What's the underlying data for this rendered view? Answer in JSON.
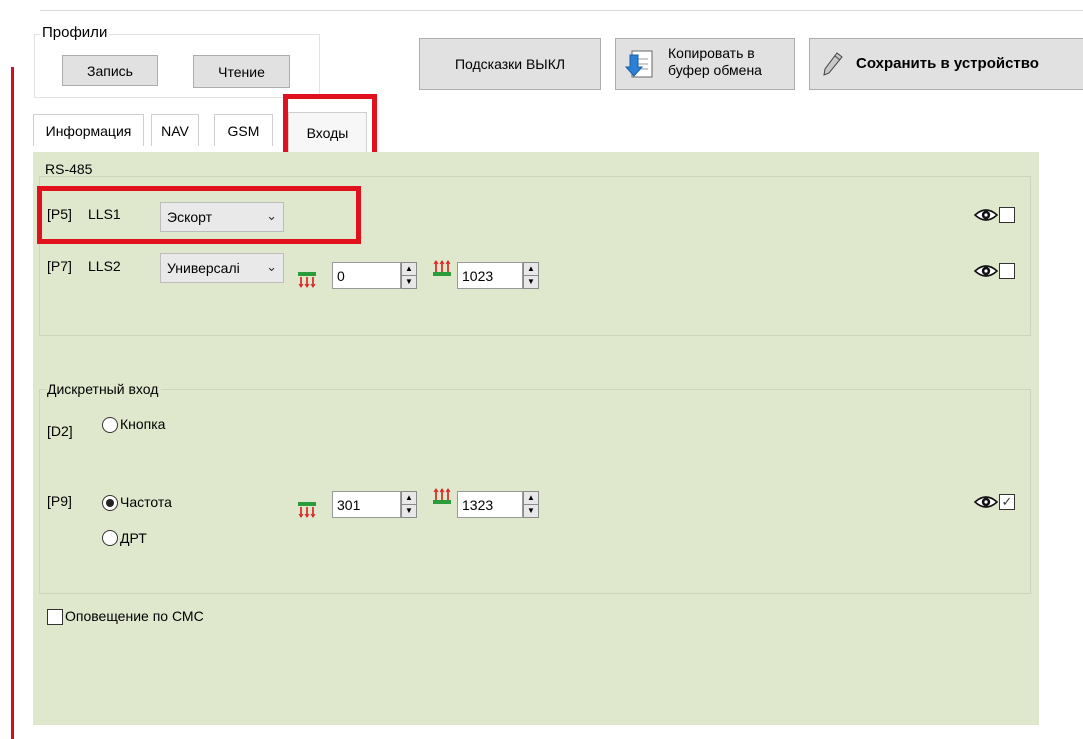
{
  "profiles": {
    "title": "Профили",
    "write_label": "Запись",
    "read_label": "Чтение"
  },
  "toolbar": {
    "hints_label": "Подсказки ВЫКЛ",
    "copy_label_line1": "Копировать в",
    "copy_label_line2": "буфер обмена",
    "save_label": "Сохранить в устройство"
  },
  "tabs": [
    {
      "label": "Информация"
    },
    {
      "label": "NAV"
    },
    {
      "label": "GSM"
    },
    {
      "label": "Входы",
      "active": true
    }
  ],
  "rs485": {
    "title": "RS-485",
    "rows": [
      {
        "port": "[P5]",
        "name": "LLS1",
        "mode": "Эскорт",
        "visible_checked": false
      },
      {
        "port": "[P7]",
        "name": "LLS2",
        "mode": "Универсалі",
        "min": "0",
        "max": "1023",
        "visible_checked": false
      }
    ]
  },
  "discrete": {
    "title": "Дискретный вход",
    "d2": {
      "port": "[D2]",
      "option": "Кнопка",
      "selected": false
    },
    "p9": {
      "port": "[P9]",
      "options": [
        {
          "label": "Частота",
          "selected": true
        },
        {
          "label": "ДРТ",
          "selected": false
        }
      ],
      "min": "301",
      "max": "1323",
      "visible_checked": true
    }
  },
  "sms": {
    "label": "Оповещение по СМС",
    "checked": false
  },
  "colors": {
    "panel_bg": "#dfe8cd",
    "highlight_red": "#e0101c",
    "sensor_green": "#2a9d3a",
    "sensor_red": "#d81c1c"
  },
  "icons": [
    "copy-to-clipboard-icon",
    "save-pen-icon",
    "eye-icon",
    "sensor-min-icon",
    "sensor-max-icon",
    "chevron-down-icon",
    "spin-up-icon",
    "spin-down-icon"
  ]
}
